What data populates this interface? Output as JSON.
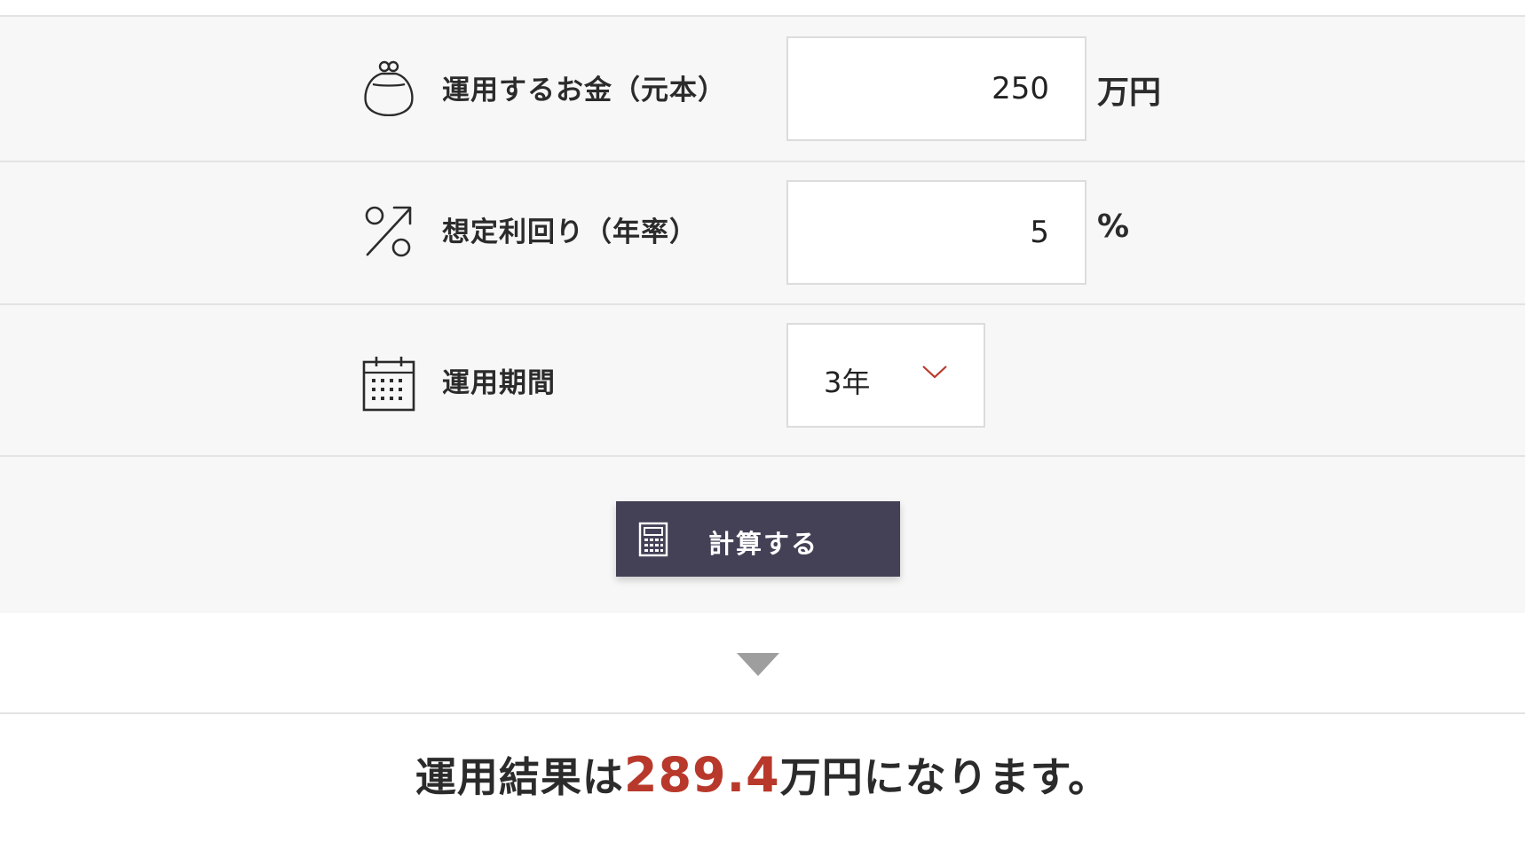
{
  "form": {
    "principal": {
      "label": "運用するお金（元本）",
      "value": "250",
      "unit": "万円",
      "icon": "purse-icon"
    },
    "yield": {
      "label": "想定利回り（年率）",
      "value": "5",
      "unit": "%",
      "icon": "percent-up-icon"
    },
    "period": {
      "label": "運用期間",
      "selected": "3年",
      "icon": "calendar-icon"
    },
    "calculate_button": {
      "label": "計算する",
      "icon": "calculator-icon"
    }
  },
  "result": {
    "prefix": "運用結果は",
    "value": "289.4",
    "suffix": "万円になります。"
  },
  "colors": {
    "accent": "#b8392b",
    "button": "#444157",
    "panel_bg": "#f7f7f7",
    "divider": "#e3e3e3",
    "arrow": "#9e9e9e"
  }
}
